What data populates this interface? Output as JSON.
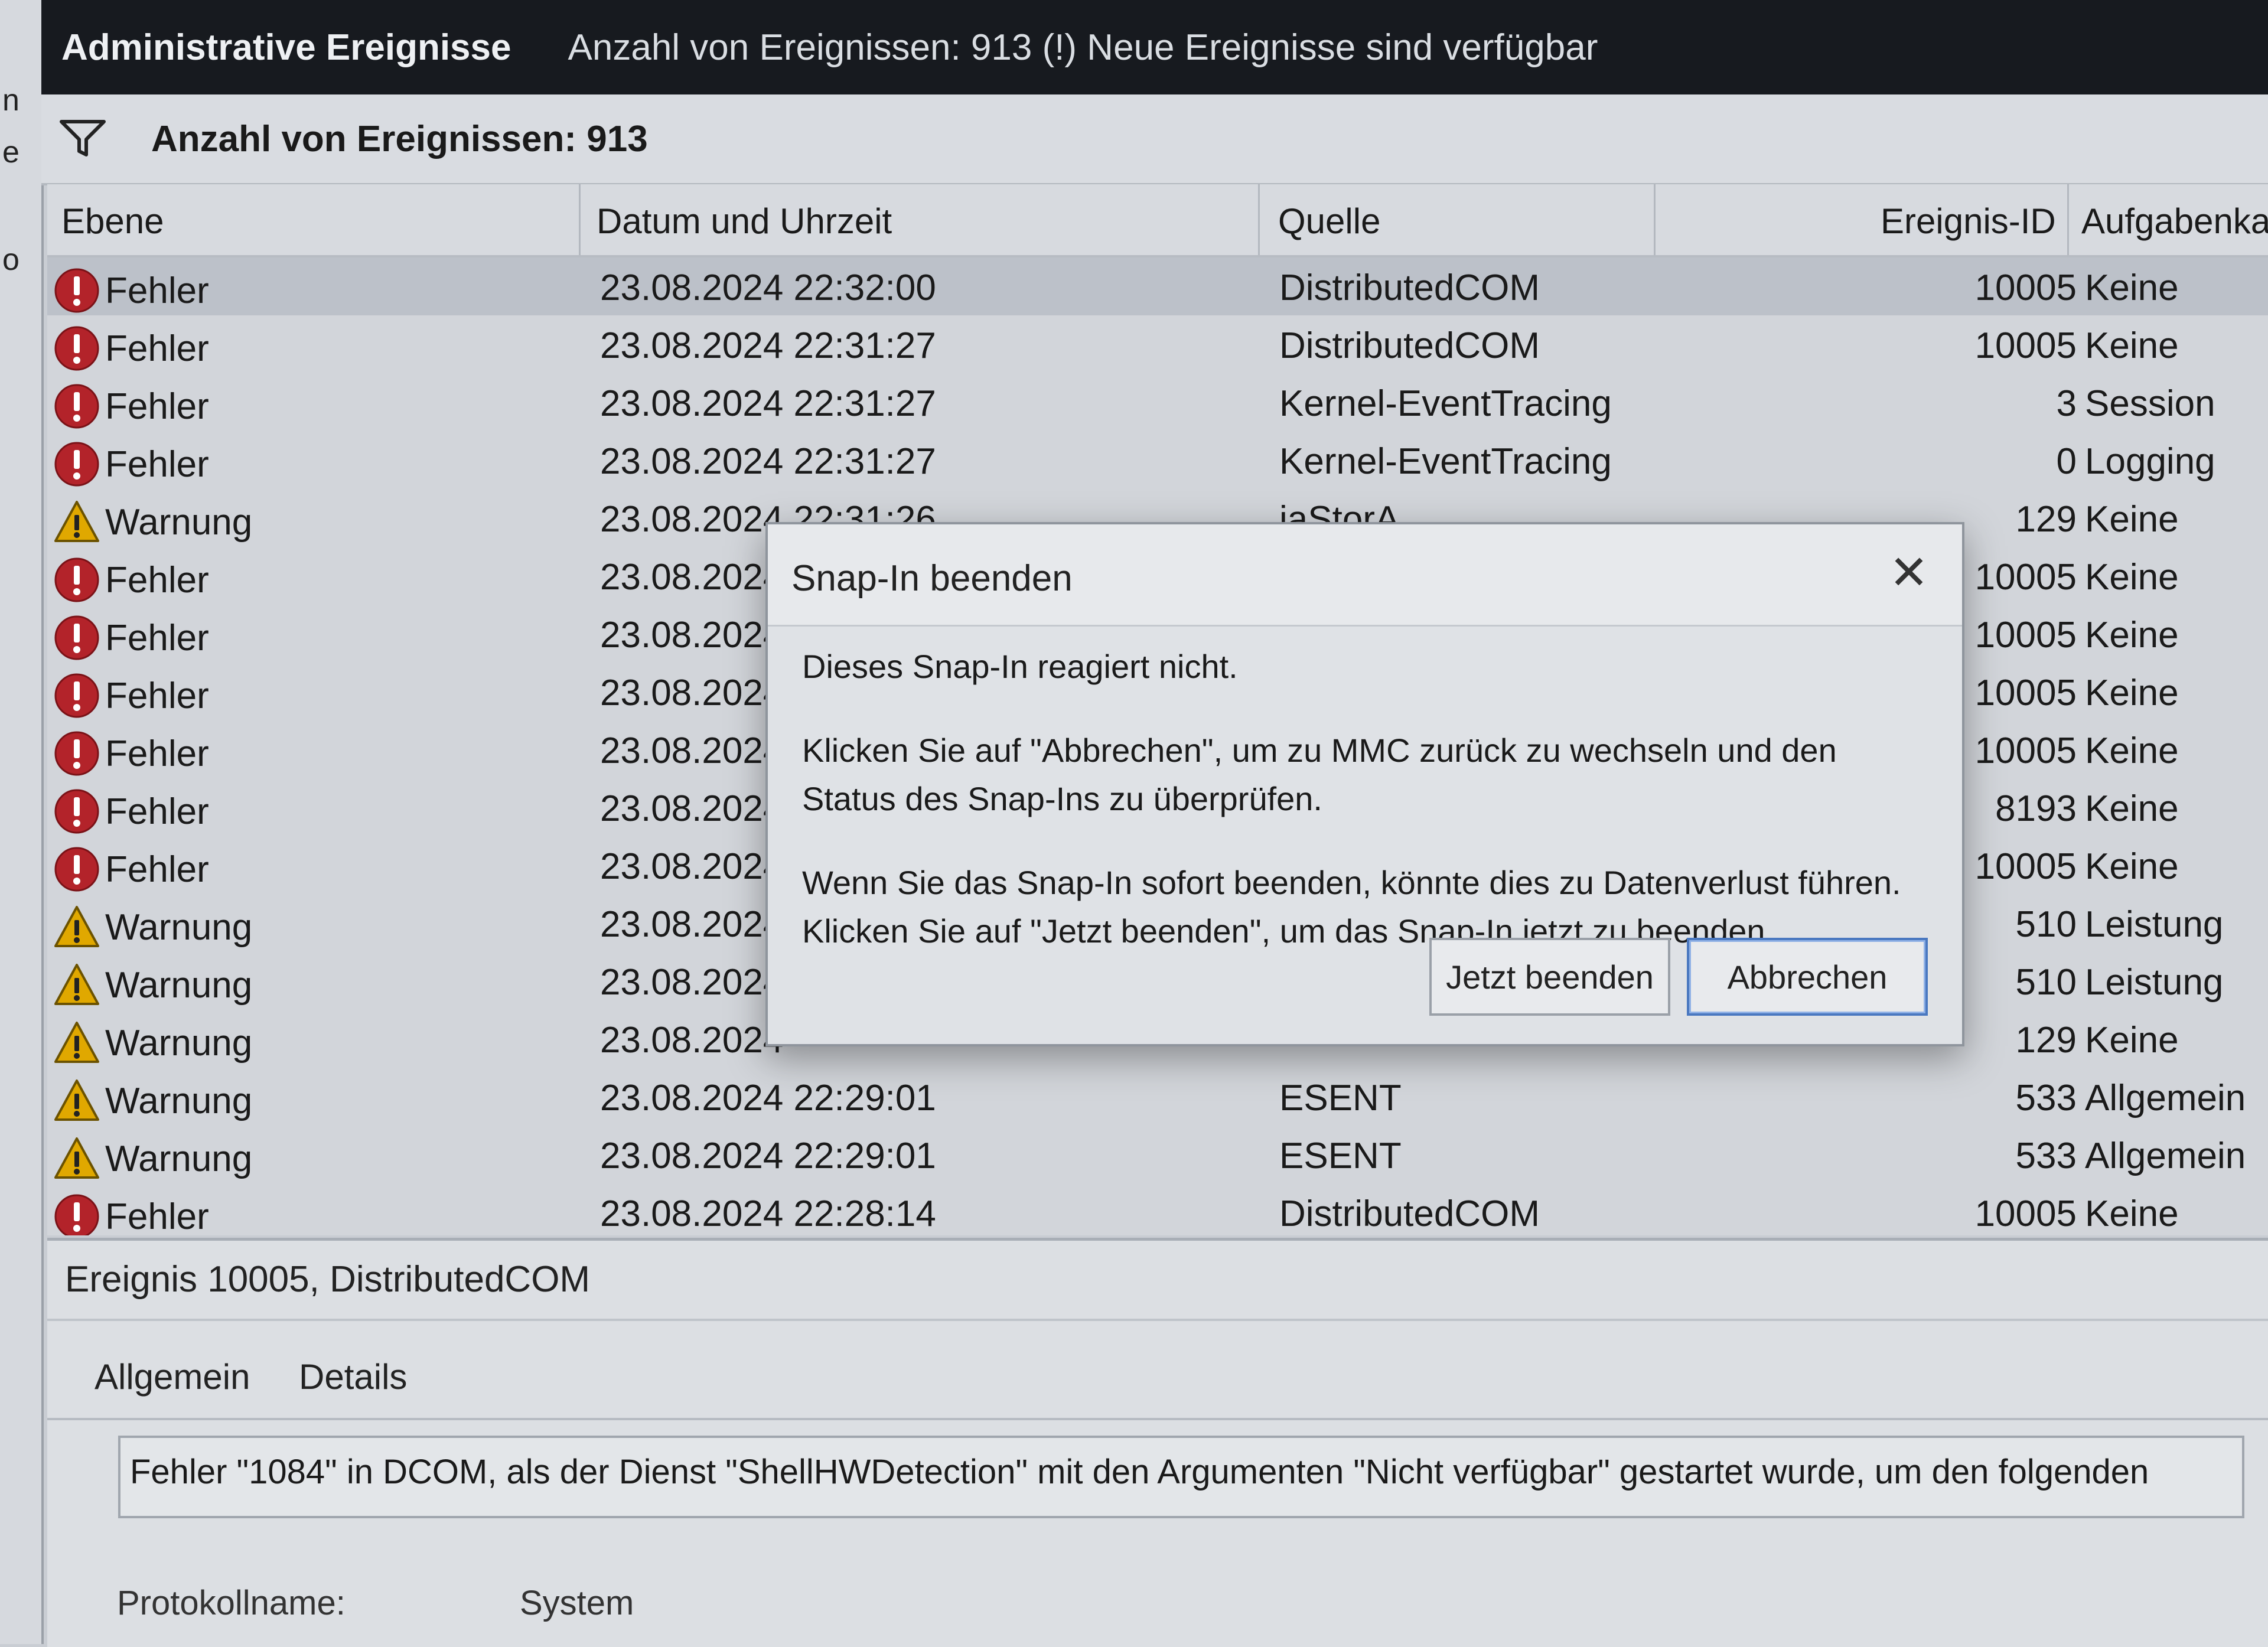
{
  "window": {
    "title": "Administrative Ereignisse",
    "status": "Anzahl von Ereignissen: 913 (!) Neue Ereignisse sind verfügbar"
  },
  "filter": {
    "label": "Anzahl von Ereignissen: 913",
    "icon": "filter-icon"
  },
  "left_strip": [
    "n",
    "e",
    "o"
  ],
  "columns": [
    "Ebene",
    "Datum und Uhrzeit",
    "Quelle",
    "Ereignis-ID",
    "Aufgabenkate"
  ],
  "rows": [
    {
      "level": "Fehler",
      "icon": "error-icon",
      "date": "23.08.2024 22:32:00",
      "source": "DistributedCOM",
      "id": "10005",
      "category": "Keine"
    },
    {
      "level": "Fehler",
      "icon": "error-icon",
      "date": "23.08.2024 22:31:27",
      "source": "DistributedCOM",
      "id": "10005",
      "category": "Keine"
    },
    {
      "level": "Fehler",
      "icon": "error-icon",
      "date": "23.08.2024 22:31:27",
      "source": "Kernel-EventTracing",
      "id": "3",
      "category": "Session"
    },
    {
      "level": "Fehler",
      "icon": "error-icon",
      "date": "23.08.2024 22:31:27",
      "source": "Kernel-EventTracing",
      "id": "0",
      "category": "Logging"
    },
    {
      "level": "Warnung",
      "icon": "warning-icon",
      "date": "23.08.2024 22:31:26",
      "source": "iaStorA",
      "id": "129",
      "category": "Keine"
    },
    {
      "level": "Fehler",
      "icon": "error-icon",
      "date": "23.08.2024",
      "source": "",
      "id": "10005",
      "category": "Keine"
    },
    {
      "level": "Fehler",
      "icon": "error-icon",
      "date": "23.08.2024",
      "source": "",
      "id": "10005",
      "category": "Keine"
    },
    {
      "level": "Fehler",
      "icon": "error-icon",
      "date": "23.08.2024",
      "source": "",
      "id": "10005",
      "category": "Keine"
    },
    {
      "level": "Fehler",
      "icon": "error-icon",
      "date": "23.08.2024",
      "source": "",
      "id": "10005",
      "category": "Keine"
    },
    {
      "level": "Fehler",
      "icon": "error-icon",
      "date": "23.08.2024",
      "source": "",
      "id": "8193",
      "category": "Keine"
    },
    {
      "level": "Fehler",
      "icon": "error-icon",
      "date": "23.08.2024",
      "source": "",
      "id": "10005",
      "category": "Keine"
    },
    {
      "level": "Warnung",
      "icon": "warning-icon",
      "date": "23.08.2024",
      "source": "",
      "id": "510",
      "category": "Leistung"
    },
    {
      "level": "Warnung",
      "icon": "warning-icon",
      "date": "23.08.2024",
      "source": "",
      "id": "510",
      "category": "Leistung"
    },
    {
      "level": "Warnung",
      "icon": "warning-icon",
      "date": "23.08.2024",
      "source": "",
      "id": "129",
      "category": "Keine"
    },
    {
      "level": "Warnung",
      "icon": "warning-icon",
      "date": "23.08.2024 22:29:01",
      "source": "ESENT",
      "id": "533",
      "category": "Allgemein"
    },
    {
      "level": "Warnung",
      "icon": "warning-icon",
      "date": "23.08.2024 22:29:01",
      "source": "ESENT",
      "id": "533",
      "category": "Allgemein"
    },
    {
      "level": "Fehler",
      "icon": "error-icon",
      "date": "23.08.2024 22:28:14",
      "source": "DistributedCOM",
      "id": "10005",
      "category": "Keine"
    }
  ],
  "dialog": {
    "title": "Snap-In beenden",
    "close": "✕",
    "message1": "Dieses Snap-In reagiert nicht.",
    "message2": "Klicken Sie auf \"Abbrechen\", um zu MMC zurück zu wechseln und den Status des Snap-Ins zu überprüfen.",
    "message3": "Wenn Sie das Snap-In sofort beenden, könnte dies zu Datenverlust führen. Klicken Sie auf \"Jetzt beenden\", um das Snap-In jetzt zu beenden.",
    "btn_end": "Jetzt beenden",
    "btn_cancel": "Abbrechen"
  },
  "detail": {
    "header": "Ereignis 10005, DistributedCOM",
    "tab_general": "Allgemein",
    "tab_details": "Details",
    "description": "Fehler \"1084\" in DCOM, als der Dienst \"ShellHWDetection\" mit den Argumenten \"Nicht verfügbar\" gestartet wurde, um den folgenden",
    "log_label": "Protokollname:",
    "log_value": "System"
  },
  "colors": {
    "error": "#b3232a",
    "warning": "#e0a800",
    "selected_row": "#bcc1c9",
    "titlebar": "#171a1f"
  }
}
